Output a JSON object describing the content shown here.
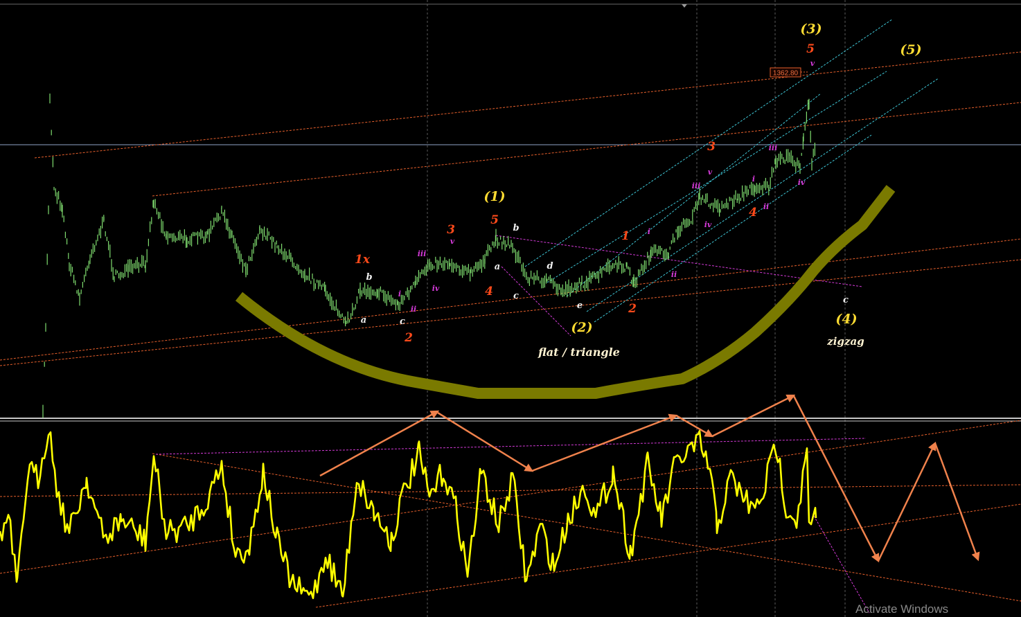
{
  "chart_data": {
    "type": "line",
    "price_panel": {
      "price_tag": "1362.80",
      "wave_labels": {
        "degree_primary": [
          "(1)",
          "(2)",
          "(3)",
          "(4)",
          "(5)"
        ],
        "intermediate": [
          "1x",
          "2",
          "3",
          "4",
          "5",
          "1",
          "2",
          "3",
          "4",
          "5"
        ],
        "minor_roman": [
          "i",
          "ii",
          "iii",
          "iv",
          "v"
        ],
        "corrective": [
          "a",
          "b",
          "c",
          "d",
          "e"
        ]
      },
      "annotations": [
        "flat / triangle",
        "zigzag"
      ]
    },
    "oscillator_panel": {
      "color": "#ffff00"
    },
    "colors": {
      "background": "#000000",
      "price_series": "#7fdc6f",
      "oscillator": "#ffff00",
      "cup_shape": "#7a7a00",
      "trend_lines": "#e8602c",
      "channel_lines": "#3fc8d8",
      "projection_arrows": "#f0824c",
      "primary_labels": "#ffdc32",
      "intermediate_labels": "#ff4a1a",
      "minor_labels": "#d43ad8",
      "corrective_labels": "#f0f0f0"
    }
  },
  "watermark": "Activate Windows"
}
